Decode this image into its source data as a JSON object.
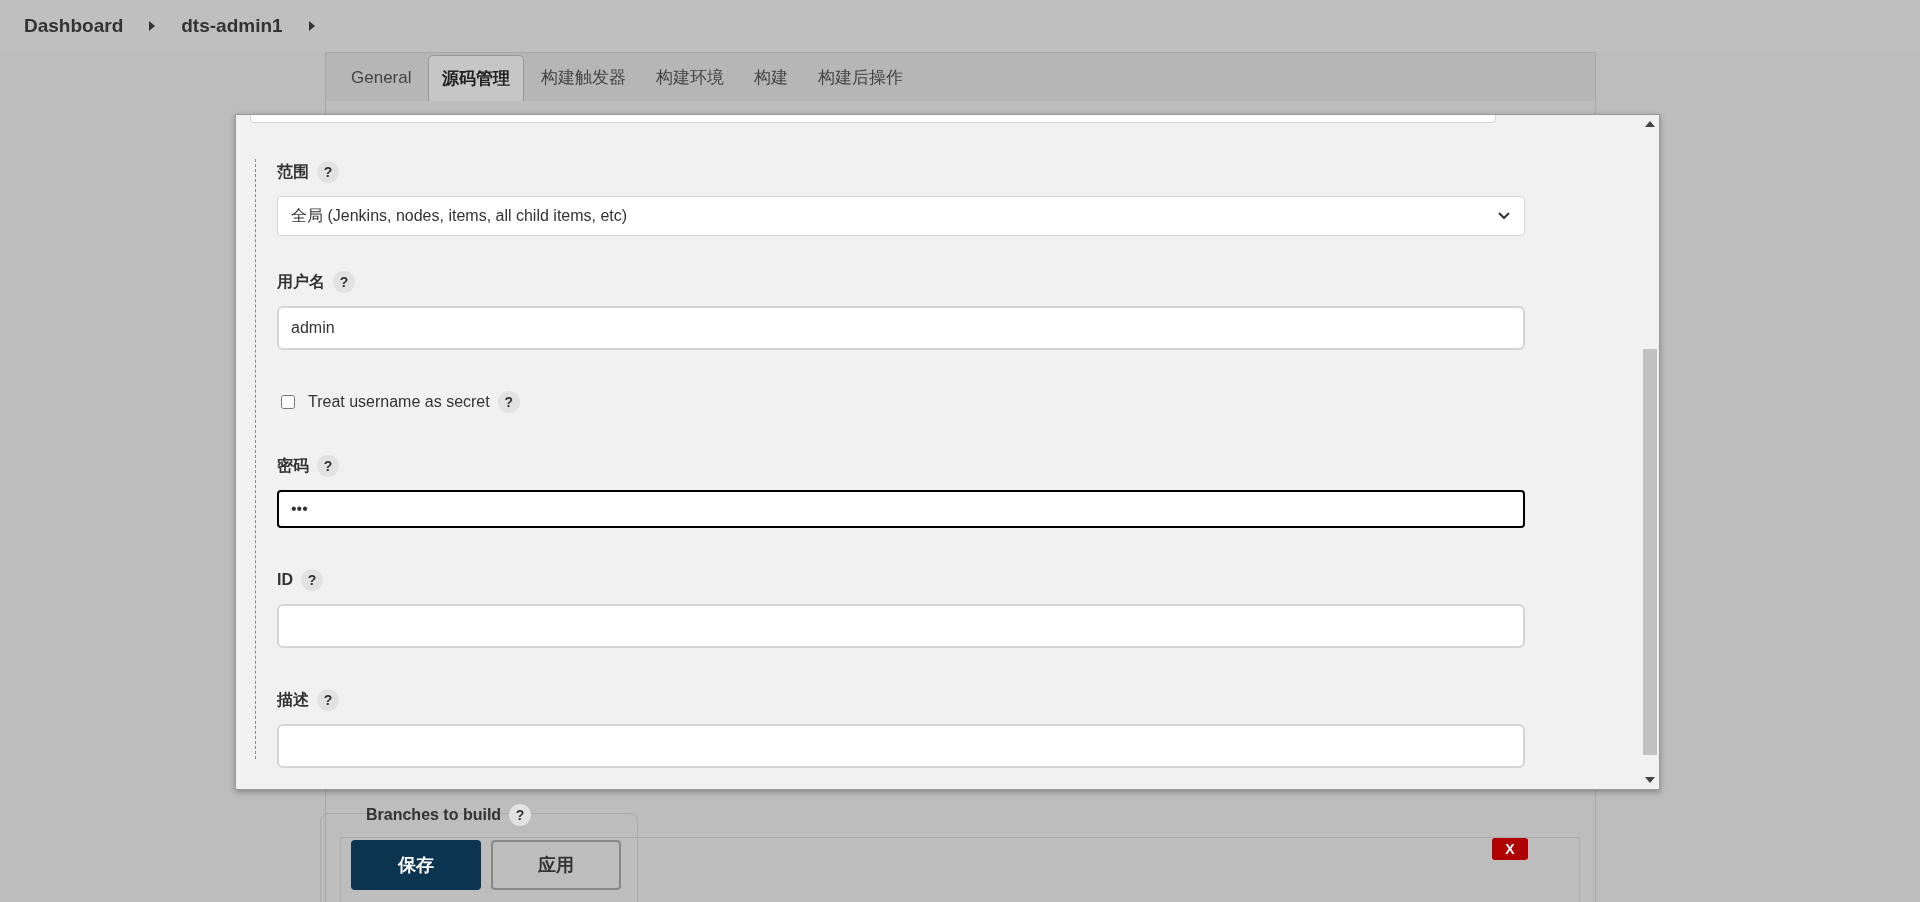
{
  "breadcrumb": [
    {
      "label": "Dashboard"
    },
    {
      "label": "dts-admin1"
    }
  ],
  "tabs": [
    {
      "label": "General",
      "selected": false
    },
    {
      "label": "源码管理",
      "selected": true
    },
    {
      "label": "构建触发器",
      "selected": false
    },
    {
      "label": "构建环境",
      "selected": false
    },
    {
      "label": "构建",
      "selected": false
    },
    {
      "label": "构建后操作",
      "selected": false
    }
  ],
  "dialog": {
    "fields": [
      {
        "kind": "select",
        "label": "范围",
        "help": "?",
        "value": "全局 (Jenkins, nodes, items, all child items, etc)"
      },
      {
        "kind": "text",
        "label": "用户名",
        "help": "?",
        "value": "admin",
        "focused": false
      },
      {
        "kind": "checkbox",
        "label": "Treat username as secret",
        "help": "?",
        "checked": false
      },
      {
        "kind": "text",
        "label": "密码",
        "help": "?",
        "value": "•••",
        "focused": true
      },
      {
        "kind": "text",
        "label": "ID",
        "help": "?",
        "focused": false
      },
      {
        "kind": "text",
        "label": "描述",
        "help": "?",
        "focused": false
      }
    ]
  },
  "branches": {
    "label": "Branches to build",
    "help": "?",
    "delete": "X"
  },
  "buttons": [
    {
      "label": "保存",
      "kind": "primary"
    },
    {
      "label": "应用",
      "kind": "secondary"
    }
  ]
}
